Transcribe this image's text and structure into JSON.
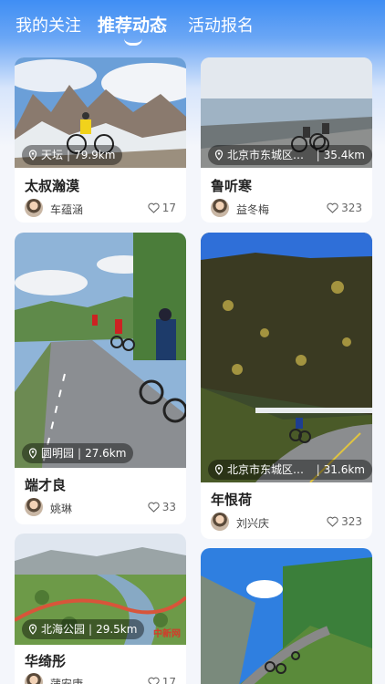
{
  "tabs": [
    {
      "label": "我的关注"
    },
    {
      "label": "推荐动态"
    },
    {
      "label": "活动报名"
    }
  ],
  "colors": {
    "accent": "#3f8ef4",
    "text": "#222222",
    "muted": "#666666"
  },
  "cards": [
    {
      "location": "天坛",
      "distance": "79.9km",
      "title": "太叔瀚漠",
      "author": "车蕴涵",
      "likes": "17"
    },
    {
      "location": "北京市东城区雍和…",
      "distance": "35.4km",
      "title": "鲁听寒",
      "author": "益冬梅",
      "likes": "323"
    },
    {
      "location": "圆明园",
      "distance": "27.6km",
      "title": "端才良",
      "author": "姚琳",
      "likes": "33"
    },
    {
      "location": "北京市东城区天坛…",
      "distance": "31.6km",
      "title": "年恨荷",
      "author": "刘兴庆",
      "likes": "323"
    },
    {
      "location": "北海公园",
      "distance": "29.5km",
      "title": "华绮彤",
      "author": "蒲安康",
      "likes": "17"
    },
    {
      "watermark": "中新网"
    }
  ],
  "icons": {
    "location": "map-pin-icon",
    "like": "heart-icon"
  }
}
